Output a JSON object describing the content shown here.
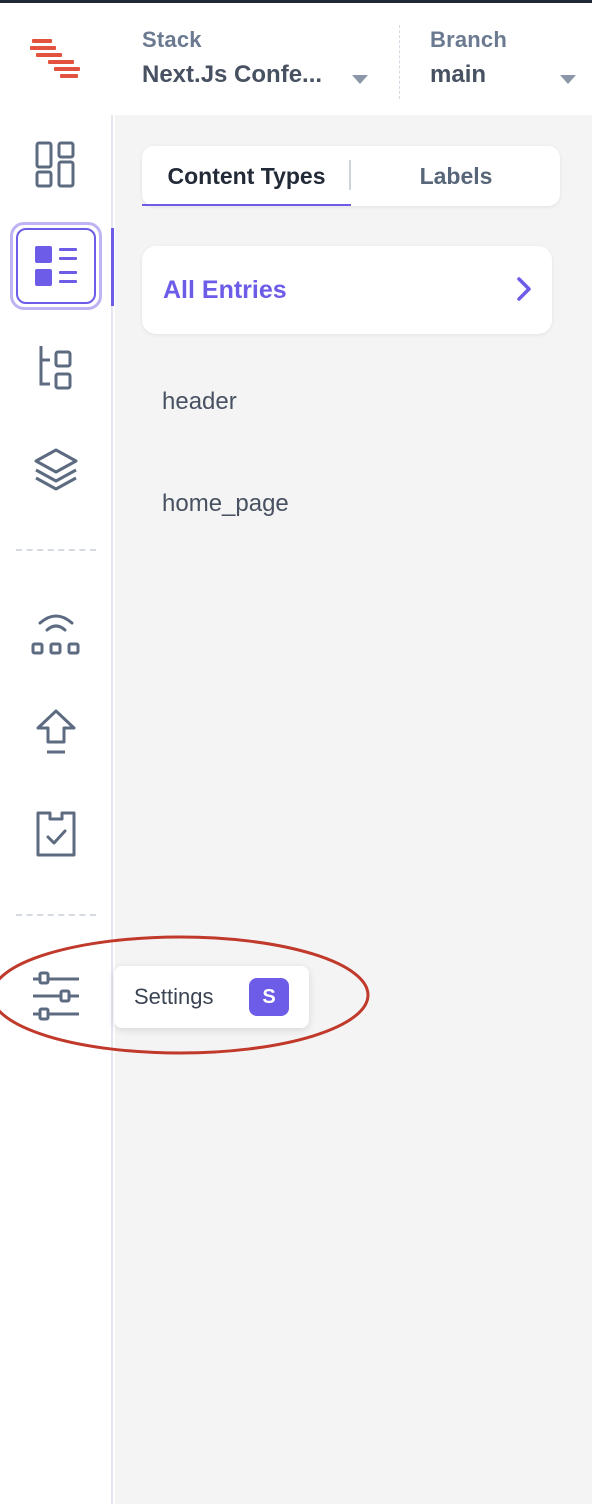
{
  "header": {
    "stack_label": "Stack",
    "stack_value": "Next.Js Confe...",
    "branch_label": "Branch",
    "branch_value": "main"
  },
  "icons": {
    "logo": "contentstack-logo-icon",
    "nav": [
      "dashboard-icon",
      "entries-icon",
      "content-models-icon",
      "assets-icon",
      "releases-icon",
      "publish-queue-icon",
      "tasks-icon",
      "settings-icon"
    ]
  },
  "tabs": [
    {
      "label": "Content Types",
      "active": true
    },
    {
      "label": "Labels",
      "active": false
    }
  ],
  "all_entries": {
    "label": "All Entries"
  },
  "content_types": [
    "header",
    "home_page"
  ],
  "tooltip": {
    "label": "Settings",
    "shortcut": "S"
  },
  "colors": {
    "accent": "#6c5ce7",
    "annotation": "#c0392b",
    "logo": "#e3523f",
    "panel_bg": "#f4f4f4"
  }
}
